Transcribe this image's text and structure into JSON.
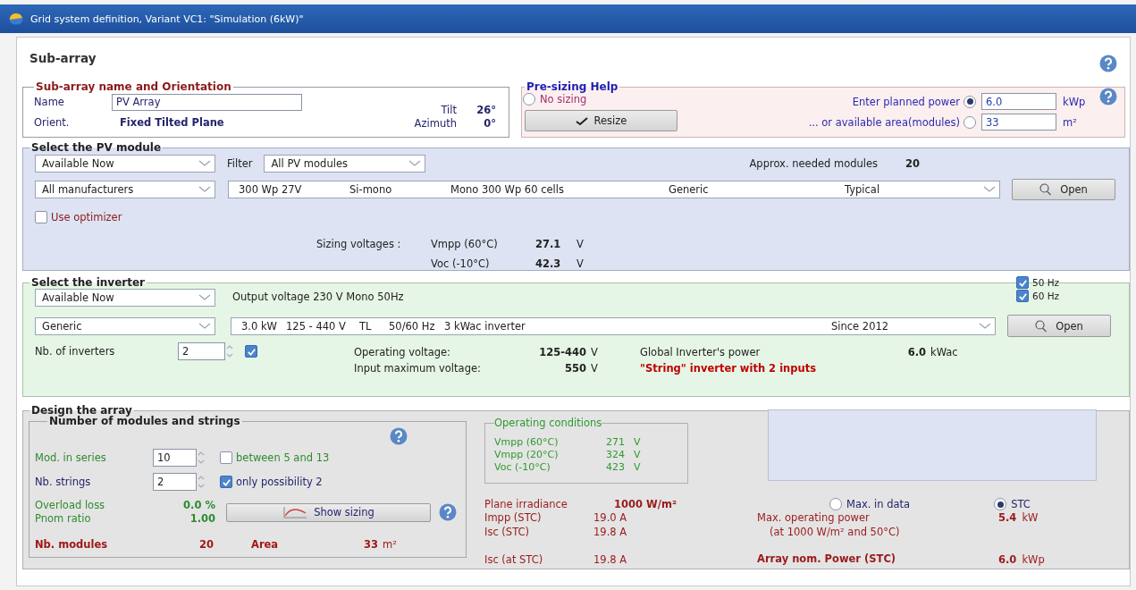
{
  "window": {
    "title": "Grid system definition, Variant VC1:  \"Simulation (6kW)\""
  },
  "heading": "Sub-array",
  "orientation": {
    "legend": "Sub-array name and Orientation",
    "name_label": "Name",
    "name_value": "PV Array",
    "orient_label": "Orient.",
    "orient_value": "Fixed Tilted Plane",
    "tilt_label": "Tilt",
    "tilt_value": "26°",
    "azimuth_label": "Azimuth",
    "azimuth_value": "0°"
  },
  "presizing": {
    "legend": "Pre-sizing Help",
    "no_sizing": {
      "label": "No sizing",
      "selected": false
    },
    "resize_button": "Resize",
    "rows": [
      {
        "label": "Enter planned power",
        "selected": true,
        "value": "6.0",
        "unit": "kWp"
      },
      {
        "label": "... or available area(modules)",
        "selected": false,
        "value": "33",
        "unit": "m²"
      }
    ]
  },
  "module": {
    "legend": "Select the PV module",
    "availability": "Available Now",
    "filter_label": "Filter",
    "filter": "All PV modules",
    "needed_label": "Approx. needed modules",
    "needed_value": "20",
    "manufacturer": "All manufacturers",
    "model_columns": [
      "300 Wp 27V",
      "Si-mono",
      "Mono 300 Wp 60 cells",
      "Generic",
      "Typical"
    ],
    "open_button": "Open",
    "optimizer": {
      "label": "Use optimizer",
      "checked": false
    },
    "sizing_label": "Sizing voltages :",
    "voltages": [
      {
        "label": "Vmpp (60°C)",
        "value": "27.1",
        "unit": "V"
      },
      {
        "label": "Voc (-10°C)",
        "value": "42.3",
        "unit": "V"
      }
    ]
  },
  "inverter": {
    "legend": "Select the inverter",
    "availability": "Available Now",
    "output_voltage": "Output voltage 230 V Mono 50Hz",
    "frequencies": [
      {
        "label": "50 Hz",
        "checked": true
      },
      {
        "label": "60 Hz",
        "checked": true
      }
    ],
    "manufacturer": "Generic",
    "model_columns": [
      "3.0 kW",
      "125 - 440 V",
      "TL",
      "50/60 Hz",
      "3 kWac inverter",
      "Since 2012"
    ],
    "open_button": "Open",
    "count_label": "Nb. of inverters",
    "count": "2",
    "count_checked": true,
    "operating_label": "Operating voltage:",
    "operating_value": "125-440",
    "operating_unit": "V",
    "power_label": "Global Inverter's power",
    "power_value": "6.0",
    "power_unit": "kWac",
    "max_label": "Input maximum voltage:",
    "max_value": "550",
    "max_unit": "V",
    "string_note": "\"String\" inverter with 2 inputs"
  },
  "design": {
    "legend": "Design the array",
    "strings": {
      "legend": "Number of modules and strings",
      "series_label": "Mod. in series",
      "series": "10",
      "series_check": {
        "label": "between 5 and 13",
        "checked": false
      },
      "strings_label": "Nb. strings",
      "strings": "2",
      "strings_check": {
        "label": "only possibility 2",
        "checked": true
      },
      "overload_label": "Overload loss",
      "overload_value": "0.0 %",
      "pnom_label": "Pnom ratio",
      "pnom_value": "1.00",
      "show_button": "Show sizing",
      "modules_label": "Nb. modules",
      "modules_value": "20",
      "area_label": "Area",
      "area_value": "33",
      "area_unit": "m²"
    },
    "conditions": {
      "legend": "Operating conditions",
      "rows": [
        {
          "label": "Vmpp (60°C)",
          "value": "271",
          "unit": "V"
        },
        {
          "label": "Vmpp (20°C)",
          "value": "324",
          "unit": "V"
        },
        {
          "label": "Voc (-10°C)",
          "value": "423",
          "unit": "V"
        }
      ]
    },
    "irradiance_label": "Plane irradiance",
    "irradiance_value": "1000 W/m²",
    "currents": [
      {
        "label": "Impp (STC)",
        "value": "19.0 A"
      },
      {
        "label": "Isc (STC)",
        "value": "19.8 A"
      }
    ],
    "isc_label": "Isc (at STC)",
    "isc_value": "19.8 A",
    "modes": [
      {
        "label": "Max. in data",
        "selected": false
      },
      {
        "label": "STC",
        "selected": true
      }
    ],
    "max_power_label": "Max. operating power",
    "max_power_value": "5.4",
    "max_power_unit": "kW",
    "max_power_note": "(at 1000 W/m²  and 50°C)",
    "nom_label": "Array nom. Power (STC)",
    "nom_value": "6.0",
    "nom_unit": "kWp"
  }
}
